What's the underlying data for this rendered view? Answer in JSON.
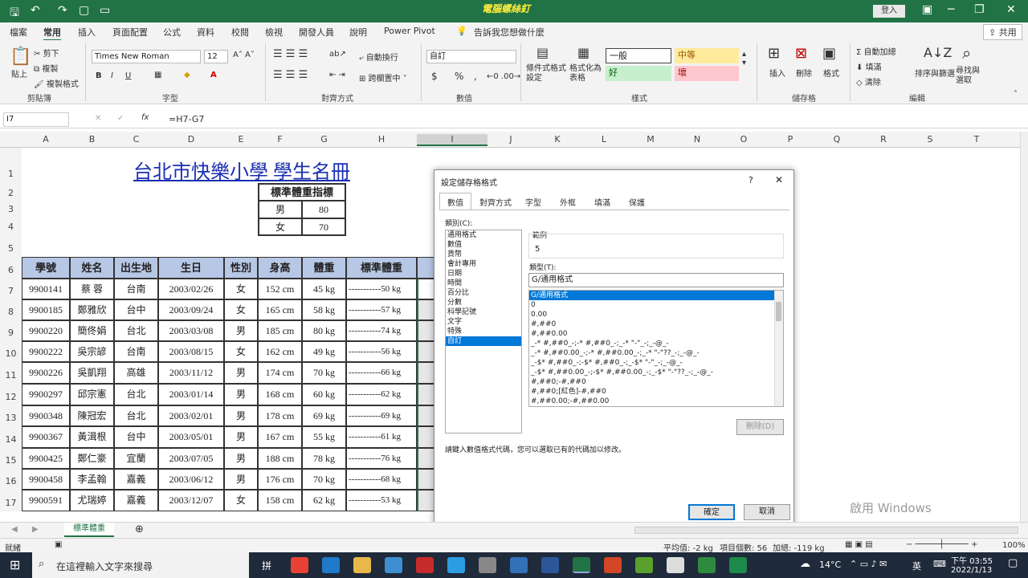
{
  "titlebar": {
    "title": "電腦螺絲釘",
    "login": "登入",
    "minimize": "─",
    "restore": "❐",
    "close": "✕"
  },
  "menu": [
    "檔案",
    "常用",
    "插入",
    "頁面配置",
    "公式",
    "資料",
    "校閱",
    "檢視",
    "開發人員",
    "說明",
    "Power Pivot"
  ],
  "menu_active": "常用",
  "tell_me": "告訴我您想做什麼",
  "share": "共用",
  "ribbon": {
    "clipboard": {
      "paste": "貼上",
      "cut": "剪下",
      "copy": "複製",
      "format_painter": "複製格式",
      "group": "剪貼簿"
    },
    "font": {
      "name": "Times New Roman",
      "size": "12",
      "bold": "B",
      "italic": "I",
      "underline": "U",
      "group": "字型"
    },
    "alignment": {
      "wrap": "自動換行",
      "merge": "跨欄置中",
      "group": "對齊方式"
    },
    "number": {
      "format": "自訂",
      "currency": "$",
      "percent": "%",
      "comma": ",",
      "group": "數值"
    },
    "styles": {
      "conditional": "條件式格式設定",
      "table": "格式化為表格",
      "normal": "一般",
      "neutral": "中等",
      "good": "好",
      "bad": "壞",
      "group": "樣式"
    },
    "cells": {
      "insert": "插入",
      "delete": "刪除",
      "format": "格式",
      "group": "儲存格"
    },
    "editing": {
      "autosum": "自動加總",
      "fill": "填滿",
      "clear": "清除",
      "sort": "排序與篩選",
      "find": "尋找與選取",
      "group": "編輯"
    }
  },
  "formula_bar": {
    "name_box": "I7",
    "fx": "fx",
    "formula": "=H7-G7"
  },
  "columns": [
    "A",
    "B",
    "C",
    "D",
    "E",
    "F",
    "G",
    "H",
    "I",
    "J",
    "K",
    "L",
    "M",
    "N",
    "O",
    "P",
    "Q",
    "R",
    "S",
    "T"
  ],
  "rows": [
    "1",
    "2",
    "3",
    "4",
    "5",
    "6",
    "7",
    "8",
    "9",
    "10",
    "11",
    "12",
    "13",
    "14",
    "15",
    "16",
    "17"
  ],
  "sheet": {
    "title": "台北市快樂小學  學生名冊",
    "std_title": "標準體重指標",
    "std": [
      {
        "g": "男",
        "v": "80"
      },
      {
        "g": "女",
        "v": "70"
      }
    ],
    "headers": [
      "學號",
      "姓名",
      "出生地",
      "生日",
      "性別",
      "身高",
      "體重",
      "標準體重"
    ],
    "records": [
      [
        "9900141",
        "蔡  蓉",
        "台南",
        "2003/02/26",
        "女",
        "152 cm",
        "45 kg",
        "-----------50 kg"
      ],
      [
        "9900185",
        "鄭雅欣",
        "台中",
        "2003/09/24",
        "女",
        "165 cm",
        "58 kg",
        "-----------57 kg"
      ],
      [
        "9900220",
        "簡佟娟",
        "台北",
        "2003/03/08",
        "男",
        "185 cm",
        "80 kg",
        "-----------74 kg"
      ],
      [
        "9900222",
        "吳宗諺",
        "台南",
        "2003/08/15",
        "女",
        "162 cm",
        "49 kg",
        "-----------56 kg"
      ],
      [
        "9900226",
        "吳凱翔",
        "高雄",
        "2003/11/12",
        "男",
        "174 cm",
        "70 kg",
        "-----------66 kg"
      ],
      [
        "9900297",
        "邱宗憲",
        "台北",
        "2003/01/14",
        "男",
        "168 cm",
        "60 kg",
        "-----------62 kg"
      ],
      [
        "9900348",
        "陳冠宏",
        "台北",
        "2003/02/01",
        "男",
        "178 cm",
        "69 kg",
        "-----------69 kg"
      ],
      [
        "9900367",
        "黃湒根",
        "台中",
        "2003/05/01",
        "男",
        "167 cm",
        "55 kg",
        "-----------61 kg"
      ],
      [
        "9900425",
        "鄭仁豪",
        "宜蘭",
        "2003/07/05",
        "男",
        "188 cm",
        "78 kg",
        "-----------76 kg"
      ],
      [
        "9900458",
        "李孟翰",
        "嘉義",
        "2003/06/12",
        "男",
        "176 cm",
        "70 kg",
        "-----------68 kg"
      ],
      [
        "9900591",
        "尤瑞婷",
        "嘉義",
        "2003/12/07",
        "女",
        "158 cm",
        "62 kg",
        "-----------53 kg"
      ]
    ]
  },
  "dialog": {
    "title": "設定儲存格格式",
    "help": "?",
    "close": "✕",
    "tabs": [
      "數值",
      "對齊方式",
      "字型",
      "外框",
      "填滿",
      "保護"
    ],
    "category_label": "類別(C):",
    "categories": [
      "通用格式",
      "數值",
      "貨幣",
      "會計專用",
      "日期",
      "時間",
      "百分比",
      "分數",
      "科學記號",
      "文字",
      "特殊",
      "自訂"
    ],
    "selected_category": "自訂",
    "sample_label": "範例",
    "sample_value": "5",
    "type_label": "類型(T):",
    "type_value": "G/通用格式",
    "types": [
      "G/通用格式",
      "0",
      "0.00",
      "#,##0",
      "#,##0.00",
      "_-* #,##0_-;-* #,##0_-;_-* \"-\"_-;_-@_-",
      "_-* #,##0.00_-;-* #,##0.00_-;_-* \"-\"??_-;_-@_-",
      "_-$* #,##0_-;-$* #,##0_-;_-$* \"-\"_-;_-@_-",
      "_-$* #,##0.00_-;-$* #,##0.00_-;_-$* \"-\"??_-;_-@_-",
      "#,##0;-#,##0",
      "#,##0;[紅色]-#,##0",
      "#,##0.00;-#,##0.00"
    ],
    "delete": "刪除(D)",
    "hint": "請鍵入數值格式代碼，您可以選取已有的代碼加以修改。",
    "ok": "確定",
    "cancel": "取消"
  },
  "sheet_tab": "標準體重",
  "status": {
    "ready": "就緒",
    "average": "平均值: -2 kg",
    "count": "項目個數: 56",
    "sum": "加總: -119 kg",
    "zoom": "100%"
  },
  "watermark": "啟用 Windows",
  "taskbar": {
    "search": "在這裡輸入文字來搜尋",
    "weather": "14°C",
    "ime": "英",
    "time": "下午 03:55",
    "date": "2022/1/13"
  }
}
